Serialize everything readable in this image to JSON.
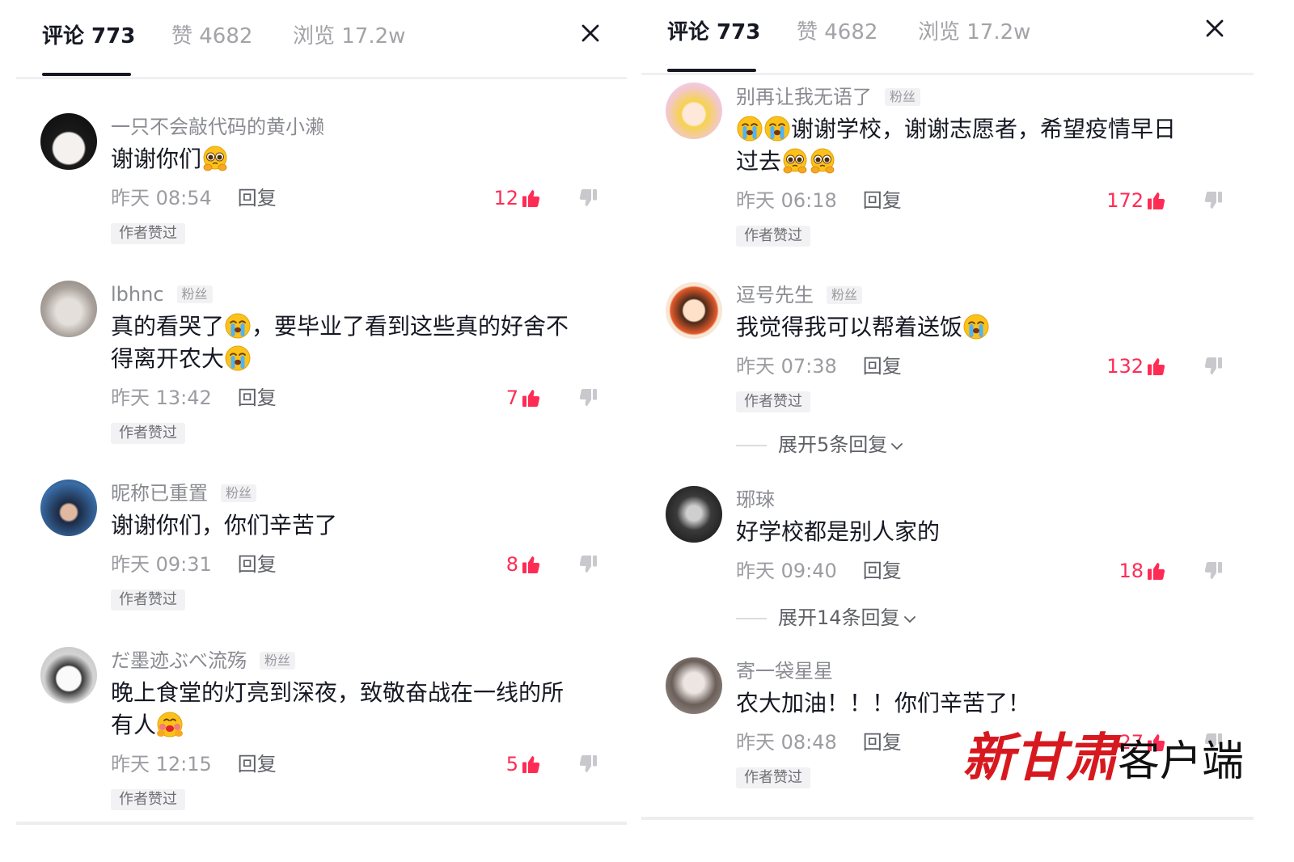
{
  "panels": [
    {
      "tabs": [
        {
          "label": "评论 773",
          "active": true
        },
        {
          "label": "赞 4682",
          "active": false
        },
        {
          "label": "浏览 17.2w",
          "active": false
        }
      ],
      "close_icon": "close-icon",
      "comments": [
        {
          "user": "一只不会敲代码的黄小濑",
          "lines": [
            [
              {
                "text": "谢谢你们"
              },
              {
                "emoji": "pleading-face"
              }
            ]
          ],
          "time": "昨天 08:54",
          "reply": "回复",
          "likes": "12",
          "badge": "作者赞过"
        },
        {
          "user": "lbhnc",
          "fan": "粉丝",
          "lines": [
            [
              {
                "text": "真的看哭了"
              },
              {
                "emoji": "crying-face"
              },
              {
                "text": "，要毕业了看到这些真的好舍不"
              }
            ],
            [
              {
                "text": "得离开农大"
              },
              {
                "emoji": "crying-face"
              }
            ]
          ],
          "time": "昨天 13:42",
          "reply": "回复",
          "likes": "7",
          "badge": "作者赞过"
        },
        {
          "user": "昵称已重置",
          "fan": "粉丝",
          "lines": [
            [
              {
                "text": "谢谢你们，你们辛苦了"
              }
            ]
          ],
          "time": "昨天 09:31",
          "reply": "回复",
          "likes": "8",
          "badge": "作者赞过"
        },
        {
          "user": "だ墨迹ぶべ流殇",
          "fan": "粉丝",
          "lines": [
            [
              {
                "text": "晚上食堂的灯亮到深夜，致敬奋战在一线的所"
              }
            ],
            [
              {
                "text": "有人"
              },
              {
                "emoji": "blushing-face"
              }
            ]
          ],
          "time": "昨天 12:15",
          "reply": "回复",
          "likes": "5",
          "badge": "作者赞过"
        }
      ]
    },
    {
      "tabs": [
        {
          "label": "评论 773",
          "active": true
        },
        {
          "label": "赞 4682",
          "active": false
        },
        {
          "label": "浏览 17.2w",
          "active": false
        }
      ],
      "close_icon": "close-icon",
      "comments": [
        {
          "user": "别再让我无语了",
          "fan": "粉丝",
          "lines": [
            [
              {
                "emoji": "crying-face"
              },
              {
                "emoji": "crying-face"
              },
              {
                "text": "谢谢学校，谢谢志愿者，希望疫情早日"
              }
            ],
            [
              {
                "text": "过去"
              },
              {
                "emoji": "pleading-face"
              },
              {
                "emoji": "pleading-face"
              }
            ]
          ],
          "time": "昨天 06:18",
          "reply": "回复",
          "likes": "172",
          "badge": "作者赞过"
        },
        {
          "user": "逗号先生",
          "fan": "粉丝",
          "lines": [
            [
              {
                "text": "我觉得我可以帮着送饭"
              },
              {
                "emoji": "crying-face"
              }
            ]
          ],
          "time": "昨天 07:38",
          "reply": "回复",
          "likes": "132",
          "badge": "作者赞过",
          "expand": "展开5条回复"
        },
        {
          "user": "琊琜",
          "lines": [
            [
              {
                "text": "好学校都是别人家的"
              }
            ]
          ],
          "time": "昨天 09:40",
          "reply": "回复",
          "likes": "18",
          "expand": "展开14条回复"
        },
        {
          "user": "寄一袋星星",
          "lines": [
            [
              {
                "text": "农大加油！！！你们辛苦了！"
              }
            ]
          ],
          "time": "昨天 08:48",
          "reply": "回复",
          "likes": "27",
          "badge": "作者赞过"
        }
      ]
    }
  ],
  "watermark": {
    "brand": "新甘肃",
    "suffix": "客户端"
  },
  "colors": {
    "like_red": "#fe2c55",
    "text": "#161823",
    "muted": "#8a8b91",
    "badge_bg": "#f2f2f4",
    "watermark_red": "#d7191f"
  }
}
